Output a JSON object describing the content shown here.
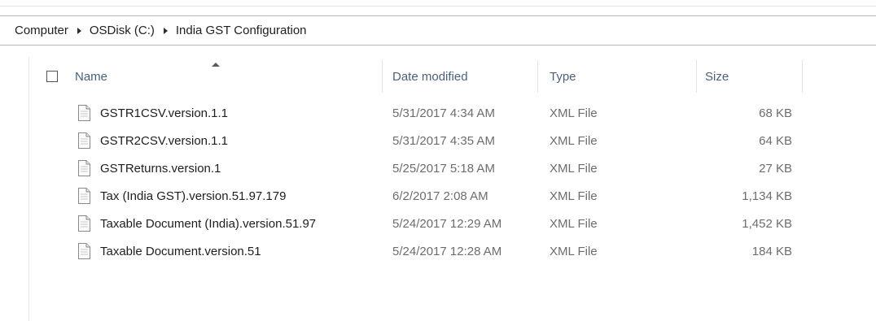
{
  "breadcrumb": [
    "Computer",
    "OSDisk (C:)",
    "India GST Configuration"
  ],
  "columns": {
    "name": "Name",
    "date": "Date modified",
    "type": "Type",
    "size": "Size"
  },
  "sort": {
    "column": "name",
    "direction": "ascending"
  },
  "files": [
    {
      "name": "GSTR1CSV.version.1.1",
      "date": "5/31/2017 4:34 AM",
      "type": "XML File",
      "size": "68 KB",
      "icon": "document-icon"
    },
    {
      "name": "GSTR2CSV.version.1.1",
      "date": "5/31/2017 4:35 AM",
      "type": "XML File",
      "size": "64 KB",
      "icon": "document-icon"
    },
    {
      "name": "GSTReturns.version.1",
      "date": "5/25/2017 5:18 AM",
      "type": "XML File",
      "size": "27 KB",
      "icon": "document-icon"
    },
    {
      "name": "Tax (India GST).version.51.97.179",
      "date": "6/2/2017 2:08 AM",
      "type": "XML File",
      "size": "1,134 KB",
      "icon": "document-icon"
    },
    {
      "name": "Taxable Document (India).version.51.97",
      "date": "5/24/2017 12:29 AM",
      "type": "XML File",
      "size": "1,452 KB",
      "icon": "document-icon"
    },
    {
      "name": "Taxable Document.version.51",
      "date": "5/24/2017 12:28 AM",
      "type": "XML File",
      "size": "184 KB",
      "icon": "document-icon"
    }
  ]
}
